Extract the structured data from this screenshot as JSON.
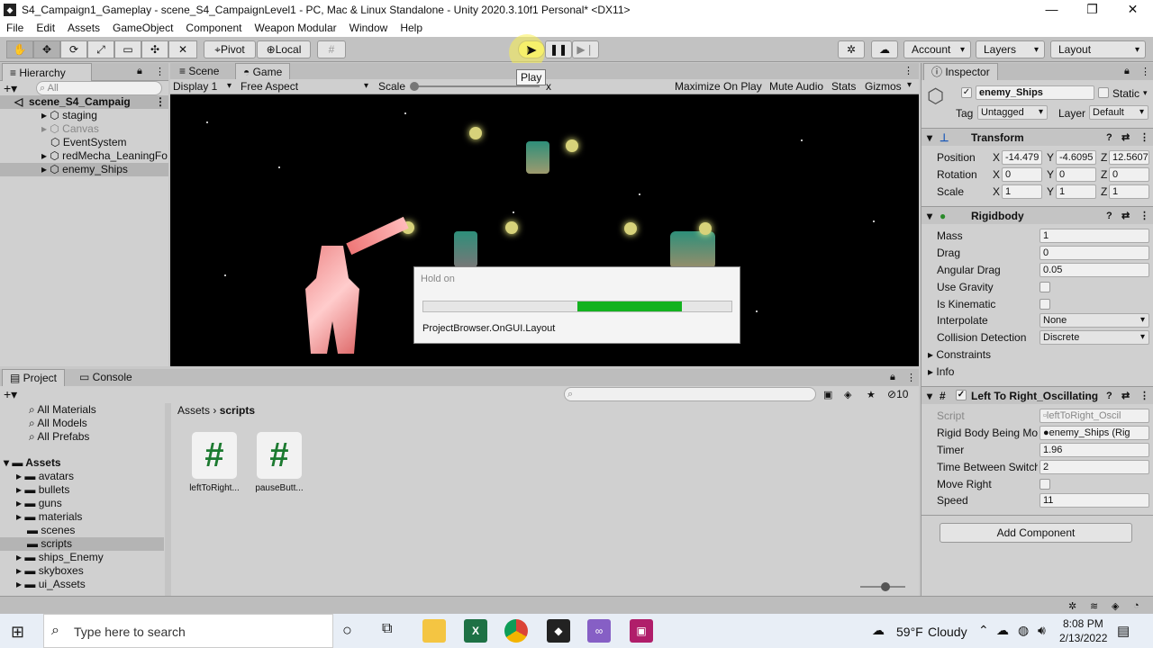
{
  "window": {
    "title": "S4_Campaign1_Gameplay - scene_S4_CampaignLevel1 - PC, Mac & Linux Standalone - Unity 2020.3.10f1 Personal* <DX11>"
  },
  "menu": [
    "File",
    "Edit",
    "Assets",
    "GameObject",
    "Component",
    "Weapon Modular",
    "Window",
    "Help"
  ],
  "toolbar": {
    "pivot": "Pivot",
    "local": "Local",
    "play_tooltip": "Play",
    "account": "Account",
    "layers": "Layers",
    "layout": "Layout"
  },
  "hierarchy": {
    "tab": "Hierarchy",
    "search_placeholder": "All",
    "scene": "scene_S4_Campaig",
    "items": [
      "staging",
      "Canvas",
      "EventSystem",
      "redMecha_LeaningFo",
      "enemy_Ships"
    ]
  },
  "scene_tabs": {
    "scene": "Scene",
    "game": "Game"
  },
  "game_bar": {
    "display": "Display 1",
    "aspect": "Free Aspect",
    "scale": "Scale",
    "scale_suffix": "x",
    "maximize": "Maximize On Play",
    "mute": "Mute Audio",
    "stats": "Stats",
    "gizmos": "Gizmos"
  },
  "dialog": {
    "title": "Hold on",
    "message": "ProjectBrowser.OnGUI.Layout",
    "progress": 0.34
  },
  "project": {
    "tab_project": "Project",
    "tab_console": "Console",
    "favorites": [
      "All Materials",
      "All Models",
      "All Prefabs"
    ],
    "assets_root": "Assets",
    "folders": [
      "avatars",
      "bullets",
      "guns",
      "materials",
      "scenes",
      "scripts",
      "ships_Enemy",
      "skyboxes",
      "ui_Assets"
    ],
    "breadcrumb_root": "Assets",
    "breadcrumb_current": "scripts",
    "files": [
      "leftToRight...",
      "pauseButt..."
    ],
    "count": "10"
  },
  "inspector": {
    "tab": "Inspector",
    "object_name": "enemy_Ships",
    "static": "Static",
    "tag_label": "Tag",
    "tag_value": "Untagged",
    "layer_label": "Layer",
    "layer_value": "Default",
    "transform": {
      "title": "Transform",
      "position_label": "Position",
      "rotation_label": "Rotation",
      "scale_label": "Scale",
      "position": [
        "-14.479",
        "-4.6095",
        "12.5607"
      ],
      "rotation": [
        "0",
        "0",
        "0"
      ],
      "scale": [
        "1",
        "1",
        "1"
      ]
    },
    "rigidbody": {
      "title": "Rigidbody",
      "mass_label": "Mass",
      "mass": "1",
      "drag_label": "Drag",
      "drag": "0",
      "angular_label": "Angular Drag",
      "angular": "0.05",
      "gravity_label": "Use Gravity",
      "kinematic_label": "Is Kinematic",
      "interpolate_label": "Interpolate",
      "interpolate": "None",
      "collision_label": "Collision Detection",
      "collision": "Discrete",
      "constraints": "Constraints",
      "info": "Info"
    },
    "script_comp": {
      "title": "Left To Right_Oscillating (",
      "script_label": "Script",
      "script_value": "leftToRight_Oscil",
      "rb_label": "Rigid Body Being Mov",
      "rb_value": "enemy_Ships (Rig",
      "timer_label": "Timer",
      "timer": "1.96",
      "tbs_label": "Time Between Switch",
      "tbs": "2",
      "move_label": "Move Right",
      "speed_label": "Speed",
      "speed": "11"
    },
    "add_component": "Add Component"
  },
  "taskbar": {
    "search": "Type here to search",
    "weather_temp": "59°F",
    "weather_desc": "Cloudy",
    "time": "8:08 PM",
    "date": "2/13/2022"
  },
  "colors": {
    "progress": "#13b21f",
    "selection": "#b4b4b4"
  }
}
